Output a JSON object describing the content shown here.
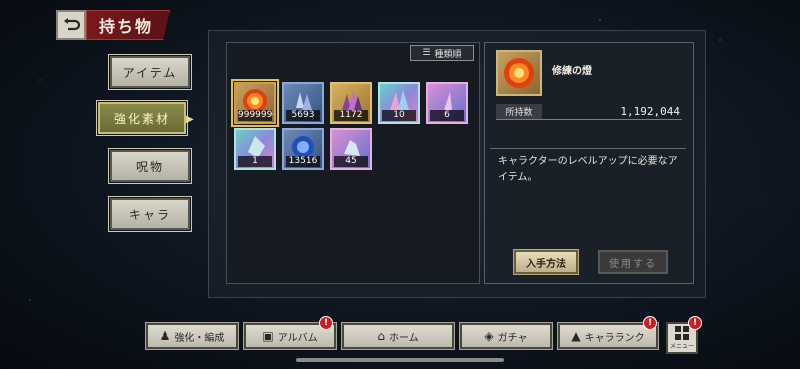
{
  "header": {
    "title": "持ち物"
  },
  "side_tabs": [
    {
      "label": "アイテム",
      "active": false
    },
    {
      "label": "強化素材",
      "active": true
    },
    {
      "label": "呪物",
      "active": false
    },
    {
      "label": "キャラ",
      "active": false
    }
  ],
  "sort_button": {
    "label": "種類順"
  },
  "items": [
    {
      "quantity": "999999+",
      "color": "orange",
      "icon": "fire-orb-icon",
      "selected": true
    },
    {
      "quantity": "5693",
      "color": "blue",
      "icon": "crystal-cluster-icon"
    },
    {
      "quantity": "1172",
      "color": "gold",
      "icon": "dark-crystal-icon"
    },
    {
      "quantity": "10",
      "color": "rainbow",
      "icon": "rainbow-crystal-icon"
    },
    {
      "quantity": "6",
      "color": "pink",
      "icon": "pink-shard-icon"
    },
    {
      "quantity": "1",
      "color": "rainbow",
      "icon": "prism-crystal-icon"
    },
    {
      "quantity": "13516",
      "color": "blue",
      "icon": "blue-orb-icon"
    },
    {
      "quantity": "45",
      "color": "pink",
      "icon": "ice-crystal-icon"
    }
  ],
  "detail": {
    "name": "修練の燈",
    "owned_label": "所持数",
    "owned_value": "1,192,044",
    "description": "キャラクターのレベルアップに必要なアイテム。",
    "get_button": "入手方法",
    "use_button": "使用する"
  },
  "bottom_nav": [
    {
      "label": "強化・編成",
      "icon": "party-icon",
      "badge": false
    },
    {
      "label": "アルバム",
      "icon": "album-icon",
      "badge": true
    },
    {
      "label": "ホーム",
      "icon": "home-icon",
      "badge": false
    },
    {
      "label": "ガチャ",
      "icon": "gacha-icon",
      "badge": false
    },
    {
      "label": "キャラランク",
      "icon": "rank-icon",
      "badge": true
    }
  ],
  "menu": {
    "label": "メニュー",
    "badge": true
  }
}
